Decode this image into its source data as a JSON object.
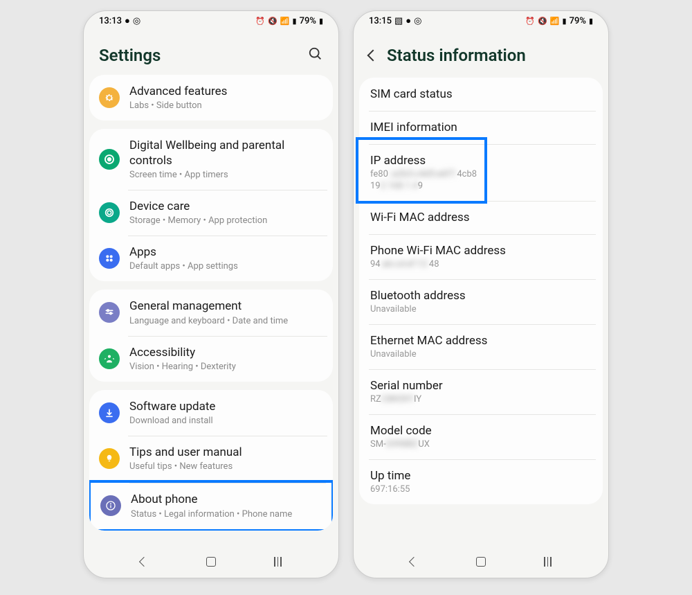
{
  "phone1": {
    "status": {
      "time": "13:13",
      "battery": "79%"
    },
    "title": "Settings",
    "groups": [
      {
        "items": [
          {
            "icon": "gear",
            "bg": "#f4b23e",
            "title": "Advanced features",
            "sub": "Labs  •  Side button"
          }
        ]
      },
      {
        "items": [
          {
            "icon": "circle-dot",
            "bg": "#0aa871",
            "title": "Digital Wellbeing and parental controls",
            "sub": "Screen time  •  App timers"
          },
          {
            "icon": "shield",
            "bg": "#0ba88a",
            "title": "Device care",
            "sub": "Storage  •  Memory  •  App protection"
          },
          {
            "icon": "dots",
            "bg": "#3a6df0",
            "title": "Apps",
            "sub": "Default apps  •  App settings"
          }
        ]
      },
      {
        "items": [
          {
            "icon": "sliders",
            "bg": "#7a7ec5",
            "title": "General management",
            "sub": "Language and keyboard  •  Date and time"
          },
          {
            "icon": "person",
            "bg": "#1eb063",
            "title": "Accessibility",
            "sub": "Vision  •  Hearing  •  Dexterity"
          }
        ]
      },
      {
        "items": [
          {
            "icon": "arrow-down",
            "bg": "#3a6df0",
            "title": "Software update",
            "sub": "Download and install"
          },
          {
            "icon": "bulb",
            "bg": "#f5b915",
            "title": "Tips and user manual",
            "sub": "Useful tips  •  New features"
          },
          {
            "icon": "info",
            "bg": "#6a6fb8",
            "title": "About phone",
            "sub": "Status  •  Legal information  •  Phone name",
            "highlight": true
          }
        ]
      }
    ]
  },
  "phone2": {
    "status": {
      "time": "13:15",
      "battery": "79%"
    },
    "title": "Status information",
    "items": [
      {
        "title": "SIM card status"
      },
      {
        "title": "IMEI information"
      },
      {
        "title": "IP address",
        "val_pre": "fe80",
        "val_blur": "::a2b3:c4d5:e6f7:",
        "val_post": "4cb8",
        "val2_pre": "19",
        "val2_blur": "2.168.1.4",
        "val2_post": "9",
        "highlight": true
      },
      {
        "title": "Wi-Fi MAC address"
      },
      {
        "title": "Phone Wi-Fi MAC address",
        "val_pre": "94",
        "val_blur": ":ab:cd:ef:12:",
        "val_post": "48"
      },
      {
        "title": "Bluetooth address",
        "val": "Unavailable"
      },
      {
        "title": "Ethernet MAC address",
        "val": "Unavailable"
      },
      {
        "title": "Serial number",
        "val_pre": "RZ",
        "val_blur": "C8K0XY",
        "val_post": "IY"
      },
      {
        "title": "Model code",
        "val_pre": "SM-",
        "val_blur": "G998BZ",
        "val_post": "UX"
      },
      {
        "title": "Up time",
        "val": "697:16:55"
      }
    ]
  }
}
